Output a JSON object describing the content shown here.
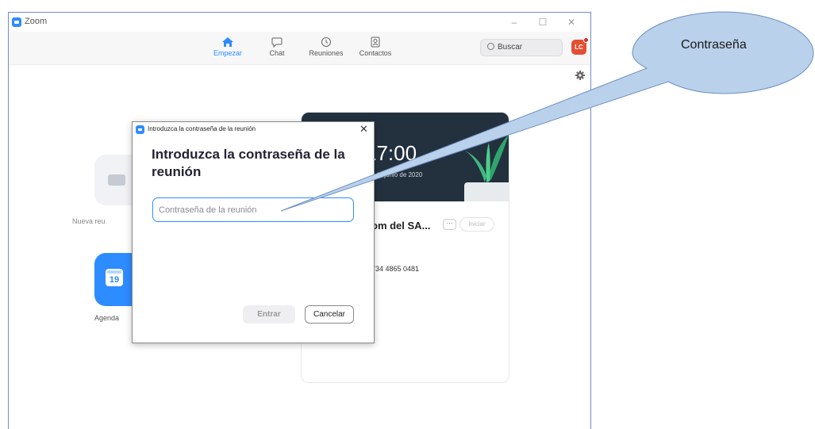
{
  "window": {
    "title": "Zoom",
    "minimize": "–",
    "maximize": "☐",
    "close": "✕"
  },
  "nav": {
    "tabs": [
      {
        "label": "Empezar",
        "icon": "home-icon",
        "active": true
      },
      {
        "label": "Chat",
        "icon": "chat-icon",
        "active": false
      },
      {
        "label": "Reuniones",
        "icon": "clock-icon",
        "active": false
      },
      {
        "label": "Contactos",
        "icon": "contacts-icon",
        "active": false
      }
    ],
    "search_label": "Buscar",
    "avatar_initials": "LC"
  },
  "home": {
    "new_meeting_label": "Nueva reu",
    "schedule_label": "Agenda",
    "calendar_day": "19"
  },
  "panel": {
    "time": "17:00",
    "date": "s. 8 de junio de 2020",
    "meeting_title": "om del SA...",
    "more": "···",
    "start_label": "Iniciar",
    "meeting_id": "734 4865 0481"
  },
  "dialog": {
    "window_title": "Introduzca la contraseña de la reunión",
    "close": "✕",
    "heading": "Introduzca la contraseña de la reunión",
    "password_placeholder": "Contraseña de la reunión",
    "enter_label": "Entrar",
    "cancel_label": "Cancelar"
  },
  "callout": {
    "text": "Contraseña"
  },
  "colors": {
    "accent": "#2d8cff",
    "callout_fill": "#b9d1ea",
    "callout_stroke": "#6f8fc4",
    "avatar": "#e34f33"
  }
}
